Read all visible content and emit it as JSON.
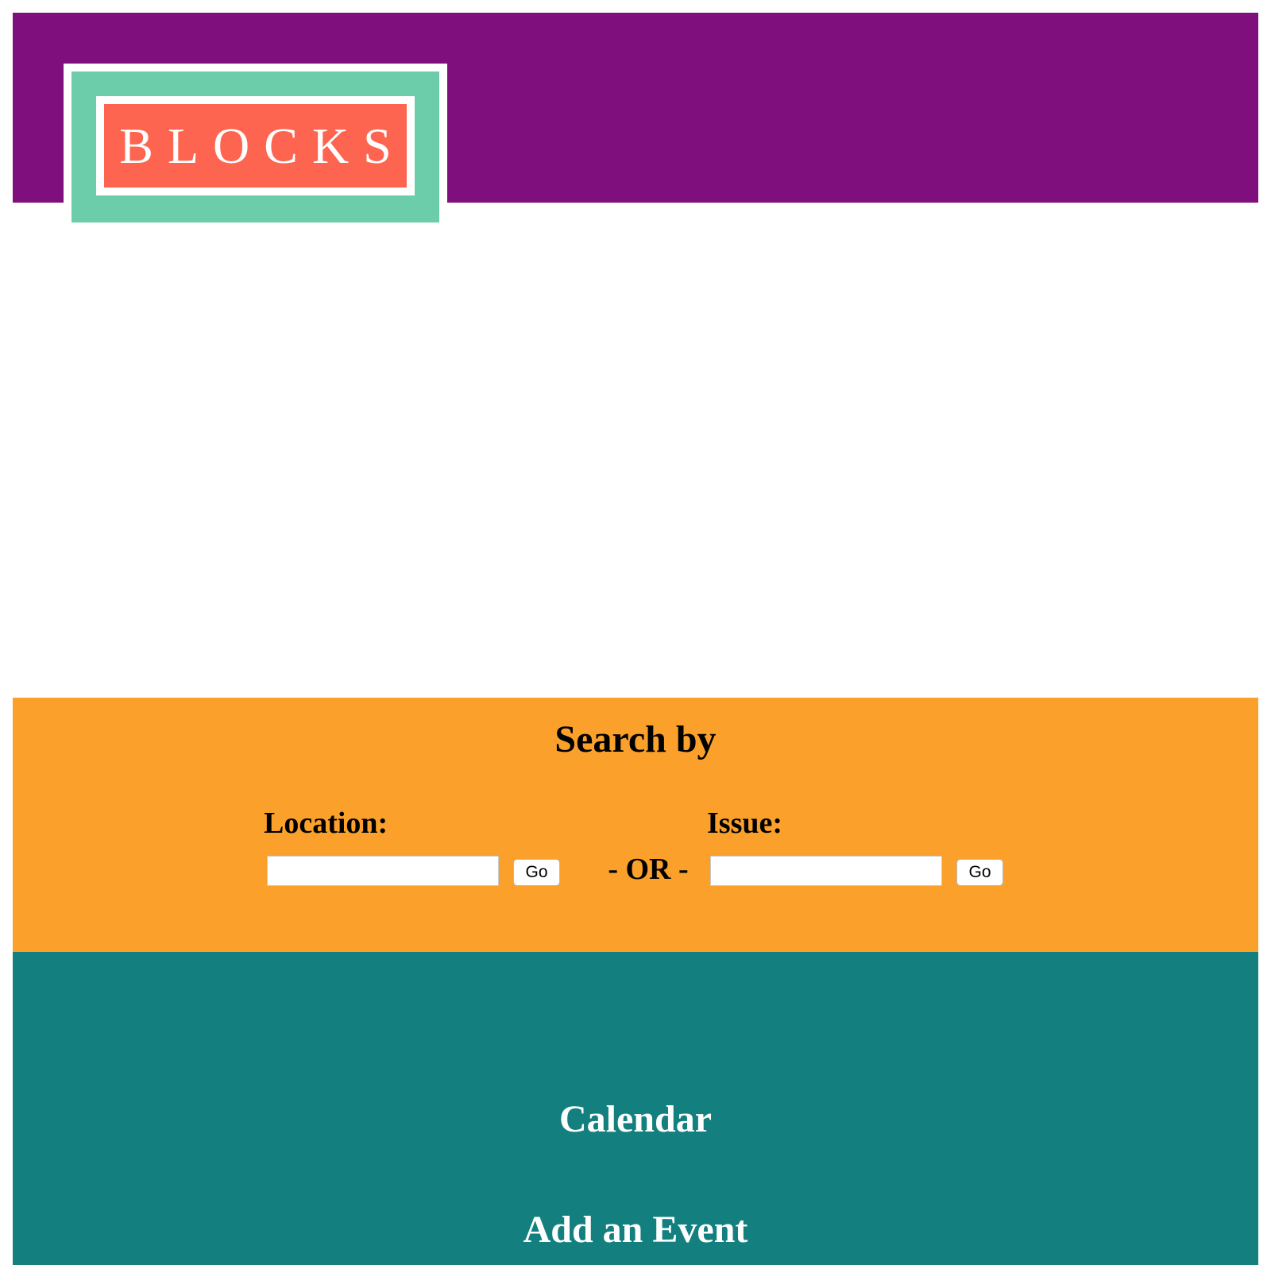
{
  "colors": {
    "header_bg": "#7f0f7c",
    "logo_mint": "#6ccdab",
    "logo_red": "#fe6550",
    "search_bg": "#fba12b",
    "links_bg": "#137f7e",
    "white": "#ffffff"
  },
  "header": {
    "logo_text": "BLOCKS"
  },
  "search": {
    "title": "Search by",
    "location_label": "Location:",
    "location_value": "",
    "location_go": "Go",
    "or_separator": "- OR -",
    "issue_label": "Issue:",
    "issue_value": "",
    "issue_go": "Go"
  },
  "nav": {
    "calendar": "Calendar",
    "add_event": "Add an Event"
  }
}
